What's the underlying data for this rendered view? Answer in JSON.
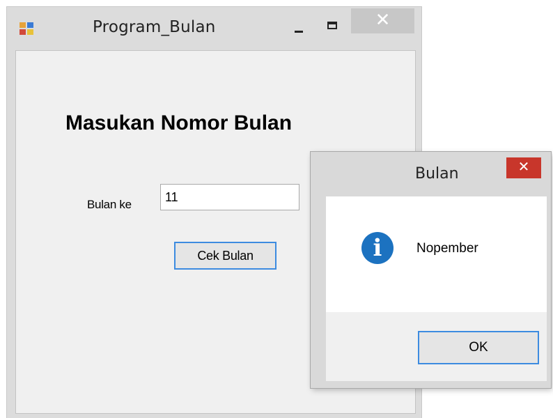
{
  "main_window": {
    "title": "Program_Bulan",
    "close_glyph": "✕",
    "heading": "Masukan Nomor Bulan",
    "input_label": "Bulan ke",
    "input_value": "11",
    "check_button": "Cek Bulan"
  },
  "message_box": {
    "title": "Bulan",
    "close_glyph": "✕",
    "icon": "information-icon",
    "message": "Nopember",
    "ok_button": "OK"
  },
  "colors": {
    "focus_border": "#3c8be0",
    "close_button_active": "#c8362b",
    "info_icon": "#1c72c0"
  }
}
